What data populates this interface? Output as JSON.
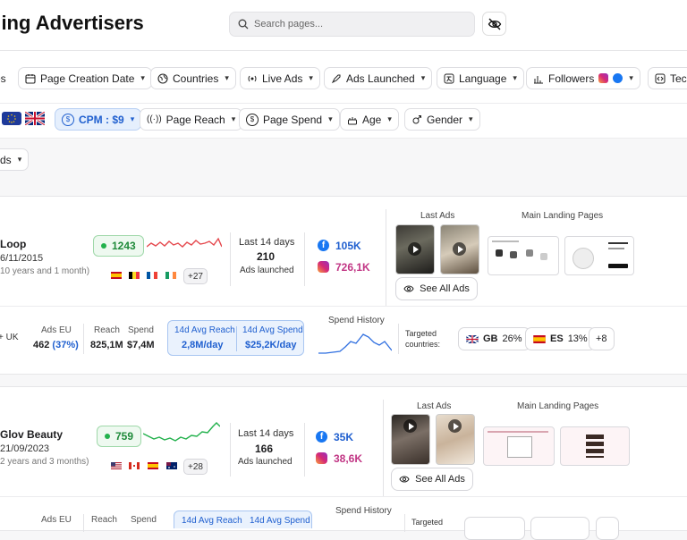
{
  "header": {
    "title": "ding Advertisers",
    "search_placeholder": "Search pages..."
  },
  "filters_row1": [
    {
      "label": "es"
    },
    {
      "label": "Page Creation Date"
    },
    {
      "label": "Countries"
    },
    {
      "label": "Live Ads"
    },
    {
      "label": "Ads Launched"
    },
    {
      "label": "Language"
    },
    {
      "label": "Followers"
    },
    {
      "label": "Tec"
    }
  ],
  "filters_row2": {
    "cpm": "CPM : $9",
    "page_reach": "Page Reach",
    "page_spend": "Page Spend",
    "age": "Age",
    "gender": "Gender"
  },
  "sort": {
    "label": "ds"
  },
  "advertisers": [
    {
      "name": "Loop",
      "date": "6/11/2015",
      "age": "10 years and 1 month)",
      "score": "1243",
      "more_countries": "+27",
      "last14_label": "Last 14 days",
      "ads_launched": "210",
      "ads_launched_label": "Ads launched",
      "facebook": "105K",
      "instagram": "726,1K",
      "last_ads_label": "Last Ads",
      "landing_label": "Main Landing Pages",
      "see_all": "See All Ads",
      "stats": {
        "uk": "+ UK",
        "ads_eu_label": "Ads EU",
        "ads_eu": "462",
        "ads_eu_pct": "(37%)",
        "reach_label": "Reach",
        "reach": "825,1M",
        "spend_label": "Spend",
        "spend": "$7,4M",
        "avg_reach_label": "14d Avg Reach",
        "avg_reach": "2,8M/day",
        "avg_spend_label": "14d Avg Spend",
        "avg_spend": "$25,2K/day",
        "spend_history_label": "Spend History",
        "targeted_label": "Targeted countries:",
        "targeted": [
          {
            "code": "GB",
            "pct": "26%"
          },
          {
            "code": "ES",
            "pct": "13%"
          }
        ],
        "targeted_more": "+8"
      }
    },
    {
      "name": "Glov Beauty",
      "date": "21/09/2023",
      "age": "2 years and 3 months)",
      "score": "759",
      "more_countries": "+28",
      "last14_label": "Last 14 days",
      "ads_launched": "166",
      "ads_launched_label": "Ads launched",
      "facebook": "35K",
      "instagram": "38,6K",
      "last_ads_label": "Last Ads",
      "landing_label": "Main Landing Pages",
      "see_all": "See All Ads",
      "stats": {
        "ads_eu_label": "Ads EU",
        "reach_label": "Reach",
        "spend_label": "Spend",
        "avg_reach_label": "14d Avg Reach",
        "avg_spend_label": "14d Avg Spend",
        "spend_history_label": "Spend History",
        "targeted_label": "Targeted"
      }
    }
  ],
  "colors": {
    "accent": "#1f5fcf",
    "green": "#22b14c",
    "instagram": "#c13584",
    "spark": "#e5484d"
  }
}
